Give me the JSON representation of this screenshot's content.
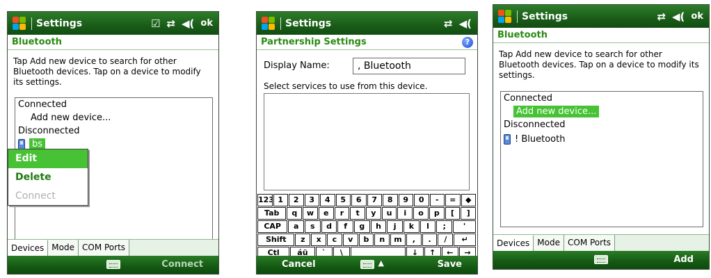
{
  "screen1": {
    "title": "Settings",
    "tray": {
      "edit_icon": "☑",
      "conn_icon": "⇄",
      "volume_icon": "◀(",
      "ok": "ok"
    },
    "section": "Bluetooth",
    "description": "Tap Add new device to search for other Bluetooth devices. Tap on a device to modify its settings.",
    "list": {
      "connected": "Connected",
      "add_new": "Add new device...",
      "disconnected": "Disconnected",
      "device_selected": "bs"
    },
    "context_menu": {
      "edit": "Edit",
      "delete": "Delete",
      "connect": "Connect"
    },
    "tabs": [
      "Devices",
      "Mode",
      "COM Ports"
    ],
    "softkeys": {
      "right": "Connect"
    }
  },
  "screen2": {
    "title": "Settings",
    "section": "Partnership Settings",
    "help": "?",
    "display_name_label": "Display Name:",
    "display_name_value": ", Bluetooth",
    "services_label": "Select services to use from this device.",
    "keyboard": [
      [
        "123",
        "1",
        "2",
        "3",
        "4",
        "5",
        "6",
        "7",
        "8",
        "9",
        "0",
        "-",
        "=",
        "◆"
      ],
      [
        "Tab",
        "q",
        "w",
        "e",
        "r",
        "t",
        "y",
        "u",
        "i",
        "o",
        "p",
        "[",
        "]"
      ],
      [
        "CAP",
        "a",
        "s",
        "d",
        "f",
        "g",
        "h",
        "j",
        "k",
        "l",
        ";",
        "'"
      ],
      [
        "Shift",
        "z",
        "x",
        "c",
        "v",
        "b",
        "n",
        "m",
        ",",
        ".",
        "/",
        "↵"
      ],
      [
        "Ctl",
        "áü",
        "`",
        "\\",
        "",
        "↓",
        "↑",
        "←",
        "→"
      ]
    ],
    "softkeys": {
      "left": "Cancel",
      "right": "Save"
    }
  },
  "screen3": {
    "title": "Settings",
    "tray": {
      "conn_icon": "⇄",
      "volume_icon": "◀(",
      "ok": "ok"
    },
    "section": "Bluetooth",
    "description": "Tap Add new device to search for other Bluetooth devices. Tap on a device to modify its settings.",
    "list": {
      "connected": "Connected",
      "add_new": "Add new device...",
      "disconnected": "Disconnected",
      "device": "! Bluetooth"
    },
    "tabs": [
      "Devices",
      "Mode",
      "COM Ports"
    ],
    "softkeys": {
      "right": "Add"
    }
  },
  "colors": {
    "titlebar": "#1a5c18",
    "accent_green": "#46c234",
    "section_text": "#2a8a12"
  }
}
